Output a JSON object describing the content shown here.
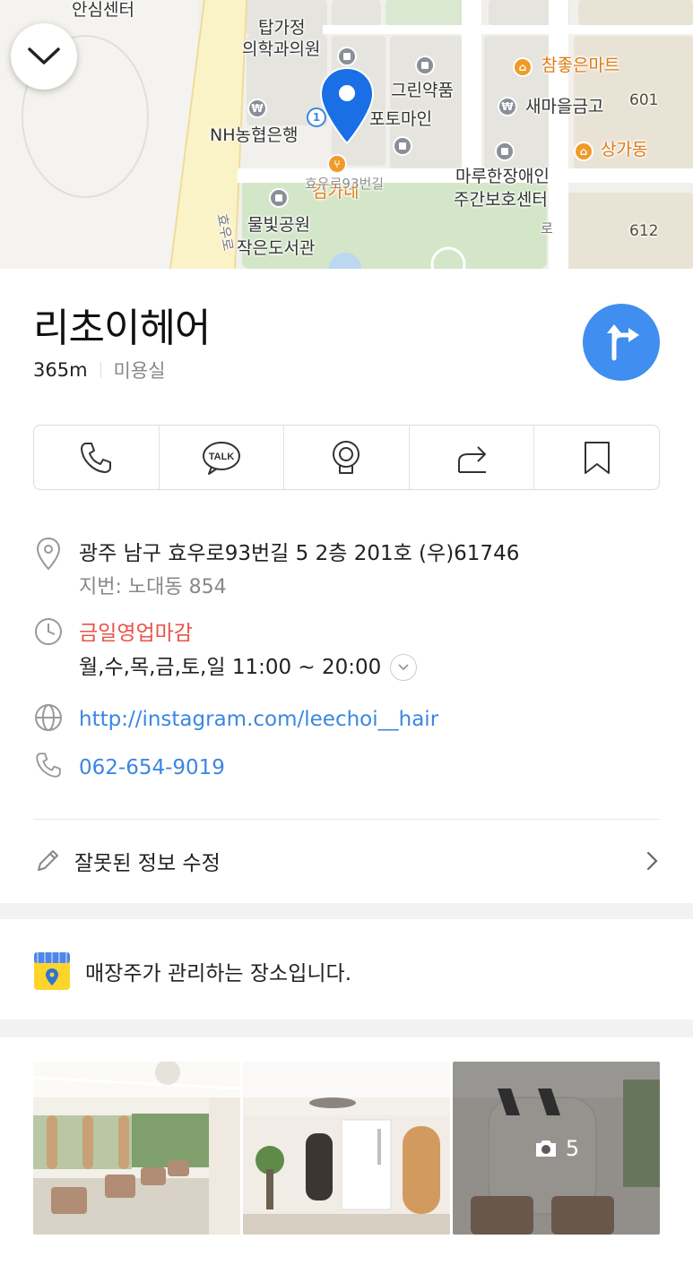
{
  "map": {
    "labels": {
      "safety_center": "안심센터",
      "tapgajeong": "탑가정",
      "clinic": "의학과의원",
      "green_pharmacy": "그린약품",
      "photo_main": "포토마인",
      "nh_bank": "NH농협은행",
      "gimgane": "김가네",
      "road_93": "효우로93번길",
      "park_library_1": "물빛공원",
      "park_library_2": "작은도서관",
      "chamjoeun_mart": "참좋은마트",
      "saemaeul": "새마을금고",
      "sangga": "상가동",
      "daycare_1": "마루한장애인",
      "daycare_2": "주간보호센터",
      "bldg_601": "601",
      "bldg_612": "612",
      "road_hyowoo": "효우로",
      "road_right": "로",
      "marker_1": "1"
    }
  },
  "place": {
    "name": "리초이헤어",
    "distance": "365m",
    "category": "미용실"
  },
  "actions": [
    {
      "name": "call",
      "icon": "phone-icon"
    },
    {
      "name": "talk",
      "icon": "talk-icon",
      "label": "TALK"
    },
    {
      "name": "roadview",
      "icon": "roadview-icon"
    },
    {
      "name": "share",
      "icon": "share-icon"
    },
    {
      "name": "save",
      "icon": "bookmark-icon"
    }
  ],
  "info": {
    "address": "광주 남구 효우로93번길 5 2층 201호 (우)61746",
    "jibun": "지번: 노대동 854",
    "status": "금일영업마감",
    "hours": "월,수,목,금,토,일 11:00 ~ 20:00",
    "website": "http://instagram.com/leechoi__hair",
    "phone": "062-654-9019"
  },
  "edit": {
    "label": "잘못된 정보 수정"
  },
  "owner": {
    "label": "매장주가 관리하는 장소입니다."
  },
  "photos": {
    "more_count": "5"
  },
  "colors": {
    "accent": "#3f8ef0",
    "closed_red": "#e9524a",
    "link_blue": "#3a87e0",
    "marker_blue": "#1a6fe6"
  }
}
